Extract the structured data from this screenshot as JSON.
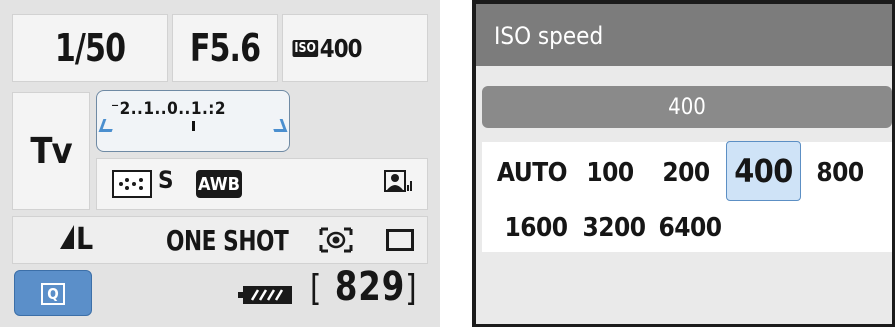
{
  "quick_control": {
    "shutter_speed": "1/50",
    "aperture": "F5.6",
    "iso_icon_text": "ISO",
    "iso_value": "400",
    "shooting_mode": "Tv",
    "exposure_scale": "⁻2..1..0..1.:2",
    "picture_style": "S",
    "white_balance": "AWB",
    "image_quality": "L",
    "af_mode": "ONE SHOT",
    "shots_remaining": "829",
    "q_button": "Q",
    "accent_color": "#5b8fc9"
  },
  "iso_menu": {
    "title": "ISO speed",
    "current_value": "400",
    "options": [
      "AUTO",
      "100",
      "200",
      "400",
      "800",
      "1600",
      "3200",
      "6400"
    ],
    "selected": "400",
    "highlight_color": "#cfe3f7"
  }
}
